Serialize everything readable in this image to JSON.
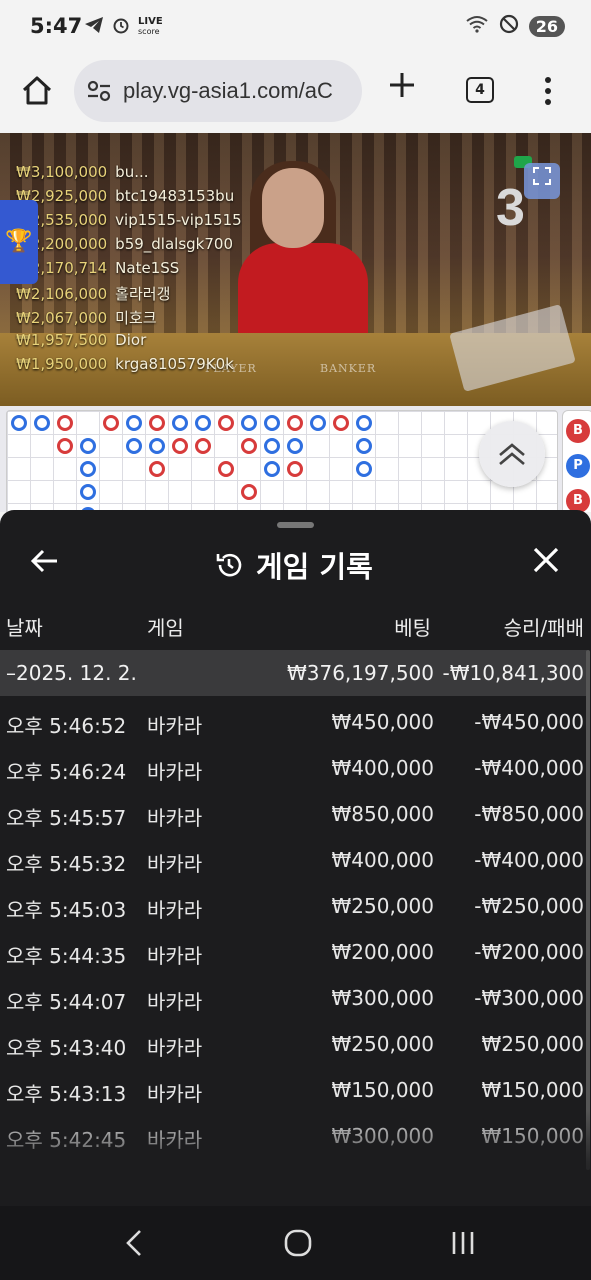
{
  "status_bar": {
    "time": "5:47",
    "live_line1": "LIVE",
    "live_line2": "score",
    "battery": "26"
  },
  "browser": {
    "url": "play.vg-asia1.com/aC",
    "tab_count": "4"
  },
  "video": {
    "shoe_number": "3",
    "table_label_left": "PLAYER",
    "table_label_right": "BANKER",
    "leaderboard": [
      {
        "amount": "₩3,100,000",
        "name": "bu..."
      },
      {
        "amount": "₩2,925,000",
        "name": "btc19483153bu"
      },
      {
        "amount": "₩2,535,000",
        "name": "vip1515-vip1515"
      },
      {
        "amount": "₩2,200,000",
        "name": "b59_dlalsgk700"
      },
      {
        "amount": "₩2,170,714",
        "name": "Nate1SS"
      },
      {
        "amount": "₩2,106,000",
        "name": "홀라러갱"
      },
      {
        "amount": "₩2,067,000",
        "name": "미호크"
      },
      {
        "amount": "₩1,957,500",
        "name": "Dior"
      },
      {
        "amount": "₩1,950,000",
        "name": "krga810579K0k"
      }
    ]
  },
  "roadmap": {
    "side_buttons": [
      "B",
      "P",
      "B"
    ]
  },
  "panel": {
    "title": "게임 기록",
    "columns": {
      "date": "날짜",
      "game": "게임",
      "bet": "베팅",
      "result": "승리/패배"
    },
    "group": {
      "date": "–2025. 12. 2.",
      "bet": "₩376,197,500",
      "result": "-₩10,841,300"
    },
    "rows": [
      {
        "date": "오후 5:46:52",
        "game": "바카라",
        "bet": "₩450,000",
        "result": "-₩450,000"
      },
      {
        "date": "오후 5:46:24",
        "game": "바카라",
        "bet": "₩400,000",
        "result": "-₩400,000"
      },
      {
        "date": "오후 5:45:57",
        "game": "바카라",
        "bet": "₩850,000",
        "result": "-₩850,000"
      },
      {
        "date": "오후 5:45:32",
        "game": "바카라",
        "bet": "₩400,000",
        "result": "-₩400,000"
      },
      {
        "date": "오후 5:45:03",
        "game": "바카라",
        "bet": "₩250,000",
        "result": "-₩250,000"
      },
      {
        "date": "오후 5:44:35",
        "game": "바카라",
        "bet": "₩200,000",
        "result": "-₩200,000"
      },
      {
        "date": "오후 5:44:07",
        "game": "바카라",
        "bet": "₩300,000",
        "result": "-₩300,000"
      },
      {
        "date": "오후 5:43:40",
        "game": "바카라",
        "bet": "₩250,000",
        "result": "₩250,000"
      },
      {
        "date": "오후 5:43:13",
        "game": "바카라",
        "bet": "₩150,000",
        "result": "₩150,000"
      },
      {
        "date": "오후 5:42:45",
        "game": "바카라",
        "bet": "₩300,000",
        "result": "₩150,000"
      }
    ]
  },
  "colors": {
    "panel_bg": "#1c1c1e",
    "group_bg": "#3a3a3c",
    "banker_red": "#d73b3b",
    "player_blue": "#2f6fe0"
  }
}
